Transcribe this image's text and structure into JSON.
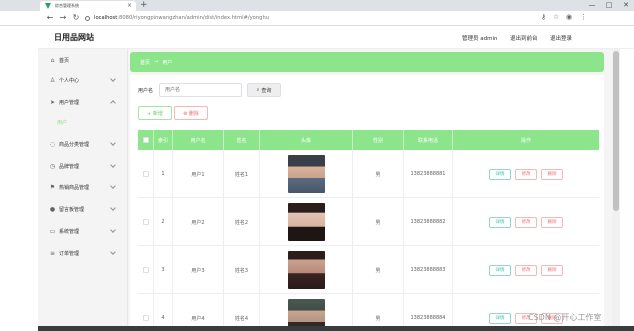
{
  "browser": {
    "tab_title": "综合管理系统",
    "url_host": "localhost",
    "url_path": ":8080/riyongpinwangzhan/admin/dist/index.html#/yonghu",
    "win_min": "—",
    "win_max": "□",
    "win_close": "✕"
  },
  "header": {
    "brand": "日用品网站",
    "admin": "管理员 admin",
    "back_front": "退出到前台",
    "logout": "退出登录"
  },
  "sidebar": {
    "items": [
      {
        "label": "首页",
        "icon": "home-icon",
        "glyph": "⌂"
      },
      {
        "label": "个人中心",
        "icon": "user-icon",
        "glyph": "♙"
      },
      {
        "label": "用户管理",
        "icon": "send-icon",
        "glyph": "➤"
      },
      {
        "label": "商品分类管理",
        "icon": "chat-icon",
        "glyph": "◌"
      },
      {
        "label": "品牌管理",
        "icon": "clock-icon",
        "glyph": "◷"
      },
      {
        "label": "热销商品管理",
        "icon": "flag-icon",
        "glyph": "⚑"
      },
      {
        "label": "留言板管理",
        "icon": "pin-icon",
        "glyph": "●"
      },
      {
        "label": "系统管理",
        "icon": "folder-icon",
        "glyph": "▭"
      },
      {
        "label": "订单管理",
        "icon": "list-icon",
        "glyph": "≡"
      }
    ],
    "subitem": "用户"
  },
  "breadcrumb": {
    "home": "首页",
    "sep": "→",
    "current": "用户"
  },
  "search": {
    "label": "用户名",
    "placeholder": "用户名",
    "button": "查询"
  },
  "actions": {
    "add": "+ 新增",
    "delete": "⊗ 删除"
  },
  "table": {
    "headers": [
      "索引",
      "用户名",
      "姓名",
      "头像",
      "性别",
      "联系电话",
      "操作"
    ],
    "rows": [
      {
        "index": "1",
        "username": "用户1",
        "name": "姓名1",
        "gender": "男",
        "phone": "13823888881"
      },
      {
        "index": "2",
        "username": "用户2",
        "name": "姓名2",
        "gender": "男",
        "phone": "13823888882"
      },
      {
        "index": "3",
        "username": "用户3",
        "name": "姓名3",
        "gender": "男",
        "phone": "13823888883"
      },
      {
        "index": "4",
        "username": "用户4",
        "name": "姓名4",
        "gender": "男",
        "phone": "13823888884"
      }
    ],
    "ops": {
      "detail": "详情",
      "edit": "修改",
      "delete": "删除"
    }
  },
  "watermark": "CSDN @开心工作室",
  "colors": {
    "accent": "#8de58b",
    "danger": "#f07070",
    "info": "#4cbcad"
  }
}
